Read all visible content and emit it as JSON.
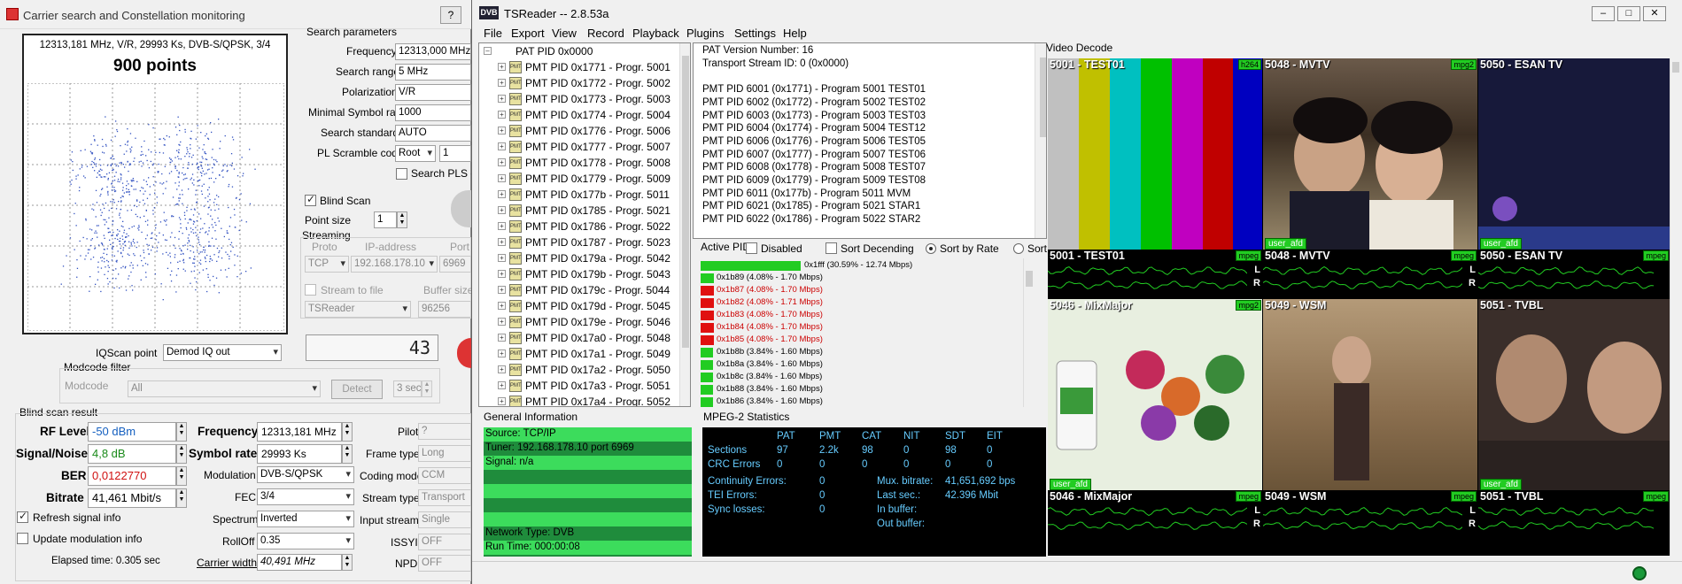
{
  "left_window": {
    "title": "Carrier search and Constellation monitoring",
    "help_btn": "?",
    "constellation": {
      "header": "12313,181 MHz, V/R, 29993 Ks, DVB-S/QPSK, 3/4",
      "points_label": "900 points"
    },
    "search_params": {
      "title": "Search parameters",
      "frequency_label": "Frequency",
      "frequency_value": "12313,000 MHz",
      "range_label": "Search range",
      "range_value": "5 MHz",
      "polarization_label": "Polarization",
      "polarization_value": "V/R",
      "min_sr_label": "Minimal Symbol rate",
      "min_sr_value": "1000",
      "standard_label": "Search standard",
      "standard_value": "AUTO",
      "pls_label": "PL Scramble code",
      "pls_mode": "Root",
      "pls_value": "1",
      "search_pls_label": "Search PLS co"
    },
    "blind_scan_label": "Blind Scan",
    "point_size_label": "Point size",
    "point_size_value": "1",
    "streaming": {
      "title": "Streaming",
      "proto_label": "Proto",
      "ip_label": "IP-address",
      "port_label": "Port",
      "proto_value": "TCP",
      "ip_value": "192.168.178.10",
      "port_value": "6969",
      "stream_to_file_label": "Stream to file",
      "buffer_label": "Buffer size",
      "target_value": "TSReader",
      "buffer_value": "96256"
    },
    "iq_label": "IQScan point",
    "iq_value": "Demod IQ out",
    "counter_value": "43",
    "modcode": {
      "title": "Modcode filter",
      "label": "Modcode",
      "value": "All",
      "detect_btn": "Detect",
      "time_value": "3 sec"
    },
    "result": {
      "title": "Blind scan result",
      "rf_label": "RF Level",
      "rf_value": "-50 dBm",
      "sn_label": "Signal/Noise",
      "sn_value": "4,8 dB",
      "ber_label": "BER",
      "ber_value": "0,0122770",
      "bitrate_label": "Bitrate",
      "bitrate_value": "41,461 Mbit/s",
      "freq_label": "Frequency",
      "freq_value": "12313,181 MHz",
      "sr_label": "Symbol rate",
      "sr_value": "29993 Ks",
      "mod_label": "Modulation",
      "mod_value": "DVB-S/QPSK",
      "fec_label": "FEC",
      "fec_value": "3/4",
      "spectrum_label": "Spectrum",
      "spectrum_value": "Inverted",
      "rolloff_label": "RollOff",
      "rolloff_value": "0.35",
      "carrier_width_label": "Carrier width",
      "carrier_width_value": "40,491 MHz",
      "pilot_label": "Pilot",
      "pilot_value": "?",
      "frame_label": "Frame type",
      "frame_value": "Long",
      "coding_label": "Coding mode",
      "coding_value": "CCM",
      "stream_type_label": "Stream type",
      "stream_type_value": "Transport",
      "input_stream_label": "Input stream",
      "input_stream_value": "Single",
      "issyi_label": "ISSYI",
      "issyi_value": "OFF",
      "npd_label": "NPD",
      "npd_value": "OFF"
    },
    "refresh_label": "Refresh signal info",
    "update_mod_label": "Update modulation info",
    "elapsed_label": "Elapsed time: 0.305 sec"
  },
  "right_window": {
    "title": "TSReader -- 2.8.53a",
    "icon_text": "DVB",
    "menu": [
      "File",
      "Export",
      "View",
      "Record",
      "Playback",
      "Plugins",
      "Settings",
      "Help"
    ],
    "tree_root": "PAT PID 0x0000",
    "tree_items": [
      "PMT PID 0x1771 - Progr. 5001",
      "PMT PID 0x1772 - Progr. 5002",
      "PMT PID 0x1773 - Progr. 5003",
      "PMT PID 0x1774 - Progr. 5004",
      "PMT PID 0x1776 - Progr. 5006",
      "PMT PID 0x1777 - Progr. 5007",
      "PMT PID 0x1778 - Progr. 5008",
      "PMT PID 0x1779 - Progr. 5009",
      "PMT PID 0x177b - Progr. 5011",
      "PMT PID 0x1785 - Progr. 5021",
      "PMT PID 0x1786 - Progr. 5022",
      "PMT PID 0x1787 - Progr. 5023",
      "PMT PID 0x179a - Progr. 5042",
      "PMT PID 0x179b - Progr. 5043",
      "PMT PID 0x179c - Progr. 5044",
      "PMT PID 0x179d - Progr. 5045",
      "PMT PID 0x179e - Progr. 5046",
      "PMT PID 0x17a0 - Progr. 5048",
      "PMT PID 0x17a1 - Progr. 5049",
      "PMT PID 0x17a2 - Progr. 5050",
      "PMT PID 0x17a3 - Progr. 5051",
      "PMT PID 0x17a4 - Progr. 5052"
    ],
    "pat_lines": [
      "PAT Version Number: 16",
      "Transport Stream ID: 0 (0x0000)",
      "",
      "PMT PID 6001 (0x1771) - Program 5001 TEST01",
      "PMT PID 6002 (0x1772) - Program 5002 TEST02",
      "PMT PID 6003 (0x1773) - Program 5003 TEST03",
      "PMT PID 6004 (0x1774) - Program 5004 TEST12",
      "PMT PID 6006 (0x1776) - Program 5006 TEST05",
      "PMT PID 6007 (0x1777) - Program 5007 TEST06",
      "PMT PID 6008 (0x1778) - Program 5008 TEST07",
      "PMT PID 6009 (0x1779) - Program 5009 TEST08",
      "PMT PID 6011 (0x177b) - Program 5011 MVM",
      "PMT PID 6021 (0x1785) - Program 5021 STAR1",
      "PMT PID 6022 (0x1786) - Program 5022 STAR2"
    ],
    "active_pids_label": "Active PIDs",
    "disabled_label": "Disabled",
    "sort_desc_label": "Sort Decending",
    "sort_rate_label": "Sort by Rate",
    "sort_pid_label": "Sort by PID",
    "pid_rows": [
      {
        "text": "0x1fff (30.59% - 12.74 Mbps)",
        "pct": 0.3059,
        "color": "#22cc22",
        "text_color": "#000"
      },
      {
        "text": "0x1b89 (4.08% - 1.70 Mbps)",
        "pct": 0.0408,
        "color": "#22cc22",
        "text_color": "#000"
      },
      {
        "text": "0x1b87 (4.08% - 1.70 Mbps)",
        "pct": 0.0408,
        "color": "#e01010",
        "text_color": "#c00"
      },
      {
        "text": "0x1b82 (4.08% - 1.71 Mbps)",
        "pct": 0.0408,
        "color": "#e01010",
        "text_color": "#c00"
      },
      {
        "text": "0x1b83 (4.08% - 1.70 Mbps)",
        "pct": 0.0408,
        "color": "#e01010",
        "text_color": "#c00"
      },
      {
        "text": "0x1b84 (4.08% - 1.70 Mbps)",
        "pct": 0.0408,
        "color": "#e01010",
        "text_color": "#c00"
      },
      {
        "text": "0x1b85 (4.08% - 1.70 Mbps)",
        "pct": 0.0408,
        "color": "#e01010",
        "text_color": "#c00"
      },
      {
        "text": "0x1b8b (3.84% - 1.60 Mbps)",
        "pct": 0.0384,
        "color": "#22cc22",
        "text_color": "#000"
      },
      {
        "text": "0x1b8a (3.84% - 1.60 Mbps)",
        "pct": 0.0384,
        "color": "#22cc22",
        "text_color": "#000"
      },
      {
        "text": "0x1b8c (3.84% - 1.60 Mbps)",
        "pct": 0.0384,
        "color": "#22cc22",
        "text_color": "#000"
      },
      {
        "text": "0x1b88 (3.84% - 1.60 Mbps)",
        "pct": 0.0384,
        "color": "#22cc22",
        "text_color": "#000"
      },
      {
        "text": "0x1b86 (3.84% - 1.60 Mbps)",
        "pct": 0.0384,
        "color": "#22cc22",
        "text_color": "#000"
      }
    ],
    "general_info_label": "General Information",
    "general_info": {
      "source": "Source: TCP/IP",
      "tuner": "Tuner: 192.168.178.10 port 6969",
      "signal": "Signal: n/a",
      "network": "Network Type: DVB",
      "runtime": "Run Time: 000:00:08"
    },
    "mpeg_label": "MPEG-2 Statistics",
    "mpeg": {
      "headers": [
        "PAT",
        "PMT",
        "CAT",
        "NIT",
        "SDT",
        "EIT"
      ],
      "sections_label": "Sections",
      "sections": [
        "97",
        "2.2k",
        "98",
        "0",
        "98",
        "0"
      ],
      "crc_label": "CRC Errors",
      "crc": [
        "0",
        "0",
        "0",
        "0",
        "0",
        "0"
      ],
      "continuity_label": "Continuity Errors:",
      "continuity_value": "0",
      "tei_label": "TEI Errors:",
      "tei_value": "0",
      "sync_label": "Sync losses:",
      "sync_value": "0",
      "mux_label": "Mux. bitrate:",
      "mux_value": "41,651,692 bps",
      "last_label": "Last sec.:",
      "last_value": "42.396 Mbit",
      "inbuf_label": "In buffer:",
      "outbuf_label": "Out buffer:"
    },
    "video_decode_label": "Video Decode",
    "tiles": [
      {
        "label": "5001 - TEST01",
        "codec": "h264",
        "afd": ""
      },
      {
        "label": "5048 - MVTV",
        "codec": "mpg2",
        "afd": "user_afd"
      },
      {
        "label": "5050 - ESAN TV",
        "codec": "mpg2",
        "afd": "user_afd"
      },
      {
        "label": "5046 - MixMajor",
        "codec": "mpg2",
        "afd": "user_afd"
      },
      {
        "label": "5049 - WSM",
        "codec": "",
        "afd": ""
      },
      {
        "label": "5051 - TVBL",
        "codec": "",
        "afd": "user_afd"
      }
    ],
    "audio": [
      {
        "label": "5001 - TEST01",
        "codec": "mpeg"
      },
      {
        "label": "5048 - MVTV",
        "codec": "mpeg"
      },
      {
        "label": "5050 - ESAN TV",
        "codec": "mpeg"
      },
      {
        "label": "5046 - MixMajor",
        "codec": "mpeg"
      },
      {
        "label": "5049 - WSM",
        "codec": "mpeg"
      },
      {
        "label": "5051 - TVBL",
        "codec": "mpeg"
      }
    ],
    "channel_left": "L",
    "channel_right": "R"
  }
}
